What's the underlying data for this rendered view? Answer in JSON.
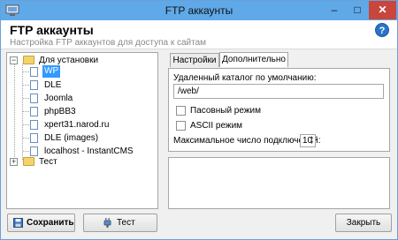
{
  "window": {
    "title": "FTP аккаунты"
  },
  "header": {
    "title": "FTP аккаунты",
    "subtitle": "Настройка FTP аккаунтов для доступа к сайтам"
  },
  "tree": {
    "groups": [
      {
        "label": "Для установки",
        "expanded": true,
        "items": [
          "WP",
          "DLE",
          "Joomla",
          "phpBB3",
          "xpert31.narod.ru",
          "DLE (images)",
          "localhost - InstantCMS"
        ],
        "selected": "WP"
      },
      {
        "label": "Тест",
        "expanded": false,
        "items": []
      }
    ]
  },
  "tabs": [
    {
      "label": "Настройки"
    },
    {
      "label": "Дополнительно",
      "active": true
    }
  ],
  "advanced": {
    "remote_dir_label": "Удаленный каталог по умолчанию:",
    "remote_dir_value": "/web/",
    "passive_label": "Пасовный режим",
    "passive_checked": false,
    "ascii_label": "ASCII режим",
    "ascii_checked": false,
    "max_conn_label": "Максимальное число подключений:",
    "max_conn_value": "10"
  },
  "buttons": {
    "save": "Сохранить",
    "test": "Тест",
    "close": "Закрыть"
  },
  "colors": {
    "titlebar": "#5fa9e8",
    "selection": "#3399ff",
    "close": "#c9463d"
  }
}
